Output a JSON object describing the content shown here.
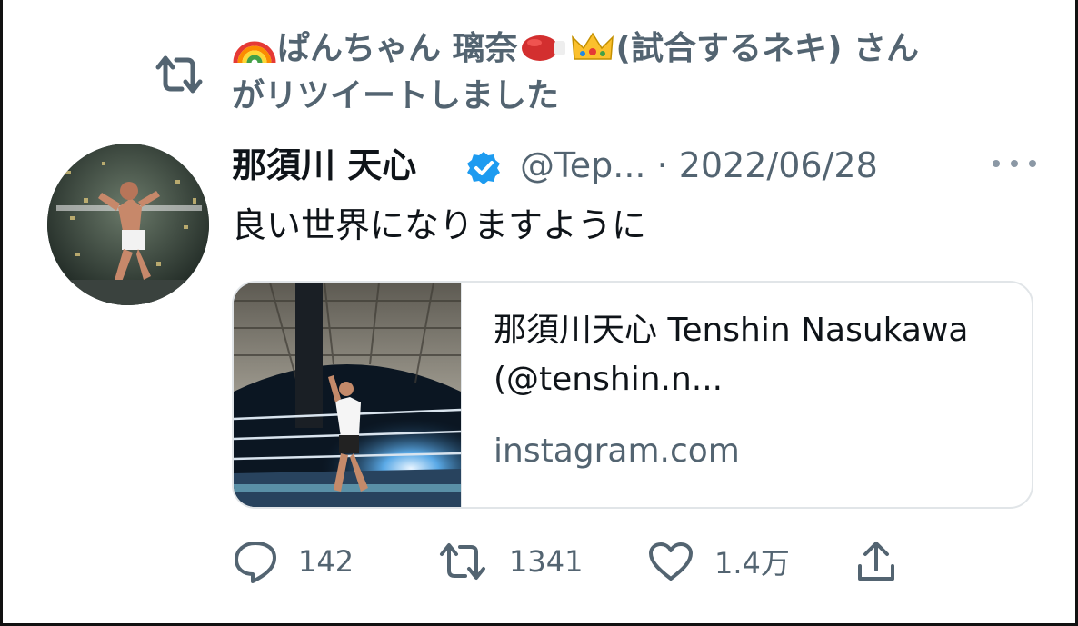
{
  "retweet": {
    "icon": "retweet-icon",
    "line1_prefix": "ぱんちゃん 璃奈",
    "line1_suffix": "(試合するネキ) さん",
    "line2": "がリツイートしました",
    "emojis": [
      "rainbow-emoji",
      "boxing-glove-emoji",
      "crown-emoji"
    ]
  },
  "tweet": {
    "author_name": "那須川 天心",
    "handle_date": "@Tep... · 2022/06/28",
    "text": "良い世界になりますように",
    "verified": true
  },
  "card": {
    "title": "那須川天心 Tenshin Nasukawa (@tenshin.n...",
    "domain": "instagram.com"
  },
  "actions": {
    "reply_count": "142",
    "retweet_count": "1341",
    "like_count": "1.4万"
  },
  "colors": {
    "text_primary": "#0f1419",
    "text_secondary": "#536471",
    "verified_blue": "#1d9bf0",
    "card_border": "#e1e5e8"
  }
}
